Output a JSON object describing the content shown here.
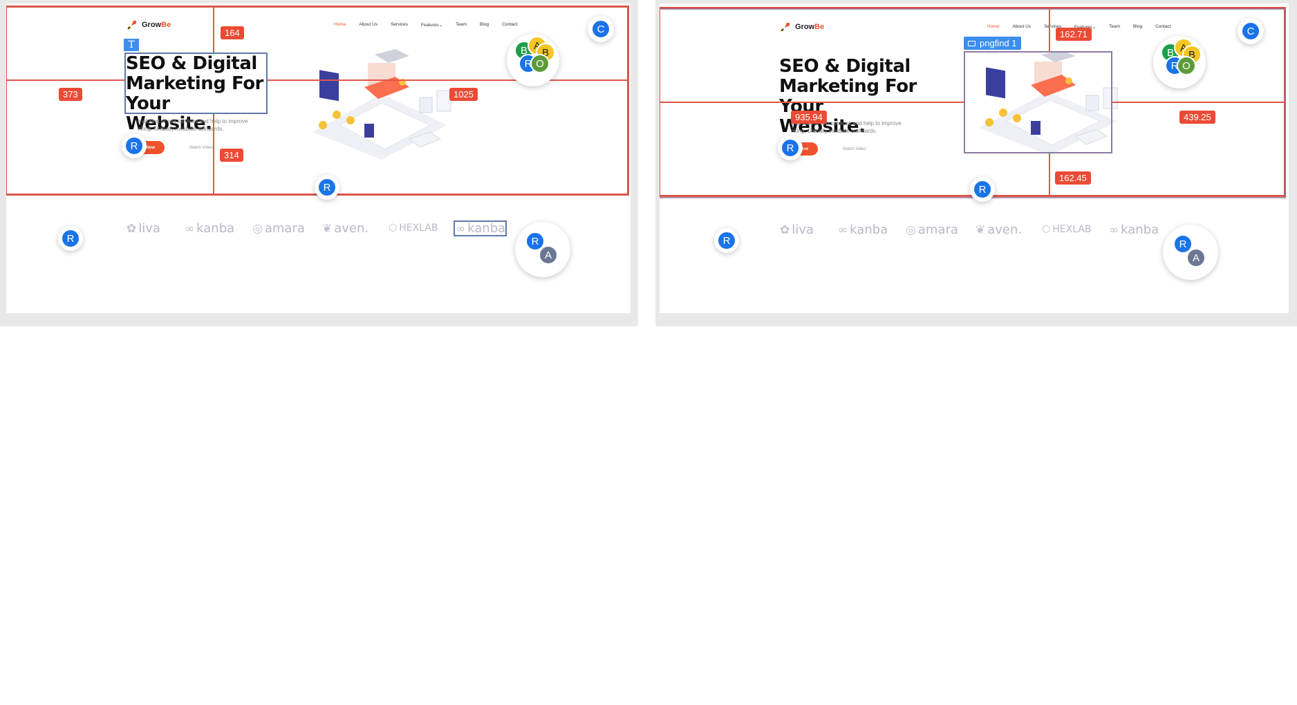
{
  "site": {
    "brand_name": "GrowBe",
    "brand_first": "Grow",
    "brand_second": "Be",
    "nav": [
      "Home",
      "About Us",
      "Services",
      "Features",
      "Team",
      "Blog",
      "Contact"
    ],
    "nav_active": "Home",
    "features_caret": "⌄",
    "hero_line1": "SEO & Digital",
    "hero_line2": "Marketing For Your",
    "hero_line3": "Website.",
    "hero_sub1": "e all kind of seo services and help to improve",
    "hero_sub2": "nking. Globally incubate standards.",
    "hero_sub1_right": "e all kind of seo services and help to improve",
    "hero_sub2_right": "nking. Globally incubate standards.",
    "start_label": "Start Now",
    "watch_label": "Watch Video",
    "partners": [
      "liva",
      "kanba",
      "amara",
      "aven.",
      "HEXLAB",
      "kanba"
    ]
  },
  "left": {
    "measure_top": "164",
    "measure_left": "373",
    "measure_right": "1025",
    "measure_bottom": "314",
    "text_tool": "T"
  },
  "right": {
    "measure_top": "162.71",
    "measure_left": "935.94",
    "measure_right": "439.25",
    "measure_bottom": "162.45",
    "selection_label": "pngfind 1"
  },
  "collaborators": {
    "c": "C",
    "r": "R",
    "a": "A",
    "b": "B",
    "o": "O"
  },
  "colors": {
    "accent": "#f0522c",
    "guide": "#e2564a",
    "collab_blue": "#1a73e8",
    "collab_green": "#1e9e4a",
    "collab_yellow": "#f3c623",
    "collab_olive": "#5d9b3b",
    "collab_slate": "#6b7793"
  }
}
